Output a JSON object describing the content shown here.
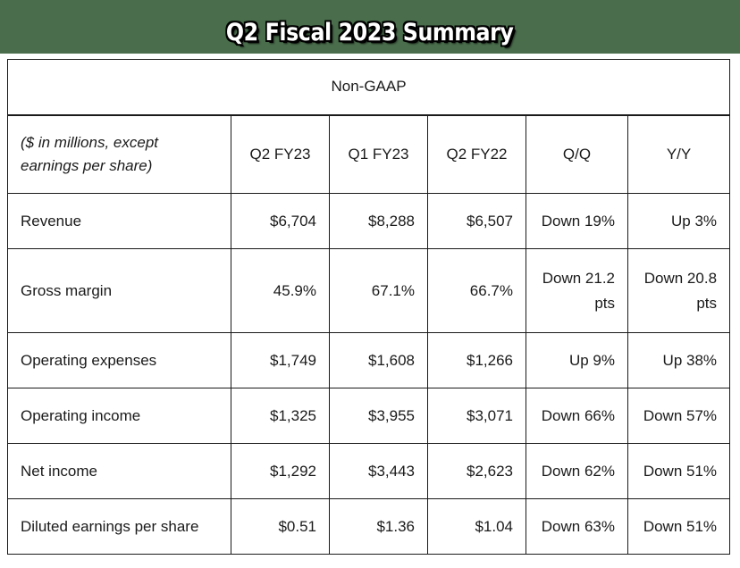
{
  "banner": {
    "title": "Q2 Fiscal 2023 Summary",
    "background_color": "#4a6e4c",
    "text_color": "#ffffff",
    "outline_color": "#000000"
  },
  "table": {
    "section_header": "Non-GAAP",
    "columns": [
      {
        "key": "metric",
        "label": "($ in millions, except earnings per share)",
        "label_line1": "($ in millions, except",
        "label_line2": "earnings per share)",
        "align": "left",
        "italic": true
      },
      {
        "key": "q2fy23",
        "label": "Q2 FY23",
        "align": "center"
      },
      {
        "key": "q1fy23",
        "label": "Q1 FY23",
        "align": "center"
      },
      {
        "key": "q2fy22",
        "label": "Q2 FY22",
        "align": "center"
      },
      {
        "key": "qoq",
        "label": "Q/Q",
        "align": "center"
      },
      {
        "key": "yoy",
        "label": "Y/Y",
        "align": "center"
      }
    ],
    "rows": [
      {
        "metric": "Revenue",
        "q2fy23": "$6,704",
        "q1fy23": "$8,288",
        "q2fy22": "$6,507",
        "qoq": "Down 19%",
        "yoy": "Up 3%",
        "tall": false
      },
      {
        "metric": "Gross margin",
        "q2fy23": "45.9%",
        "q1fy23": "67.1%",
        "q2fy22": "66.7%",
        "qoq": "Down 21.2 pts",
        "yoy": "Down 20.8 pts",
        "tall": true
      },
      {
        "metric": "Operating expenses",
        "q2fy23": "$1,749",
        "q1fy23": "$1,608",
        "q2fy22": "$1,266",
        "qoq": "Up 9%",
        "yoy": "Up 38%",
        "tall": false
      },
      {
        "metric": "Operating income",
        "q2fy23": "$1,325",
        "q1fy23": "$3,955",
        "q2fy22": "$3,071",
        "qoq": "Down 66%",
        "yoy": "Down 57%",
        "tall": false
      },
      {
        "metric": "Net income",
        "q2fy23": "$1,292",
        "q1fy23": "$3,443",
        "q2fy22": "$2,623",
        "qoq": "Down 62%",
        "yoy": "Down 51%",
        "tall": false
      },
      {
        "metric": "Diluted earnings per share",
        "q2fy23": "$0.51",
        "q1fy23": "$1.36",
        "q2fy22": "$1.04",
        "qoq": "Down 63%",
        "yoy": "Down 51%",
        "tall": false
      }
    ]
  }
}
